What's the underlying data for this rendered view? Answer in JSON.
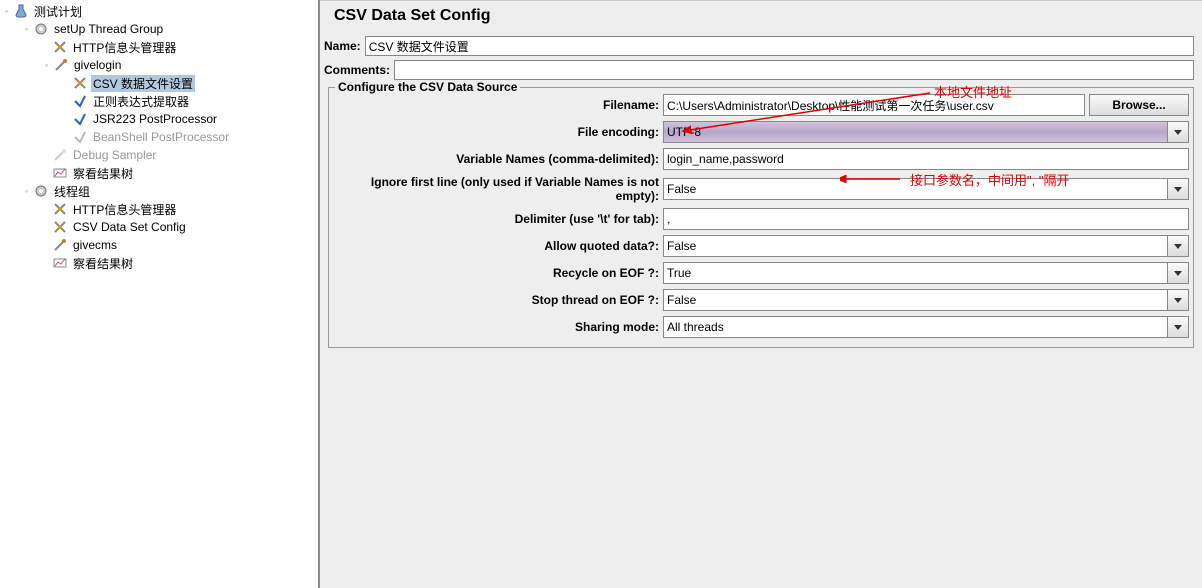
{
  "tree": {
    "root": "测试计划",
    "setup_group": "setUp Thread Group",
    "http_header1": "HTTP信息头管理器",
    "givelogin": "givelogin",
    "csv_data_set": "CSV 数据文件设置",
    "regex_extractor": "正则表达式提取器",
    "jsr223": "JSR223 PostProcessor",
    "beanshell": "BeanShell PostProcessor",
    "debug_sampler": "Debug Sampler",
    "view_results1": "察看结果树",
    "thread_group": "线程组",
    "http_header2": "HTTP信息头管理器",
    "csv_config": "CSV Data Set Config",
    "givecms": "givecms",
    "view_results2": "察看结果树"
  },
  "panel": {
    "title": "CSV Data Set Config",
    "name_label": "Name:",
    "name_value": "CSV 数据文件设置",
    "comments_label": "Comments:",
    "comments_value": "",
    "fieldset_legend": "Configure the CSV Data Source",
    "rows": {
      "filename_label": "Filename:",
      "filename_value": "C:\\Users\\Administrator\\Desktop\\性能测试第一次任务\\user.csv",
      "browse_label": "Browse...",
      "encoding_label": "File encoding:",
      "encoding_value": "UTF-8",
      "varnames_label": "Variable Names (comma-delimited):",
      "varnames_value": "login_name,password",
      "ignore_label": "Ignore first line (only used if Variable Names is not empty):",
      "ignore_value": "False",
      "delimiter_label": "Delimiter (use '\\t' for tab):",
      "delimiter_value": ",",
      "quoted_label": "Allow quoted data?:",
      "quoted_value": "False",
      "recycle_label": "Recycle on EOF ?:",
      "recycle_value": "True",
      "stop_label": "Stop thread on EOF ?:",
      "stop_value": "False",
      "sharing_label": "Sharing mode:",
      "sharing_value": "All threads"
    }
  },
  "annotations": {
    "a1": "本地文件地址",
    "a2": "接口参数名，中间用\", \"隔开"
  }
}
